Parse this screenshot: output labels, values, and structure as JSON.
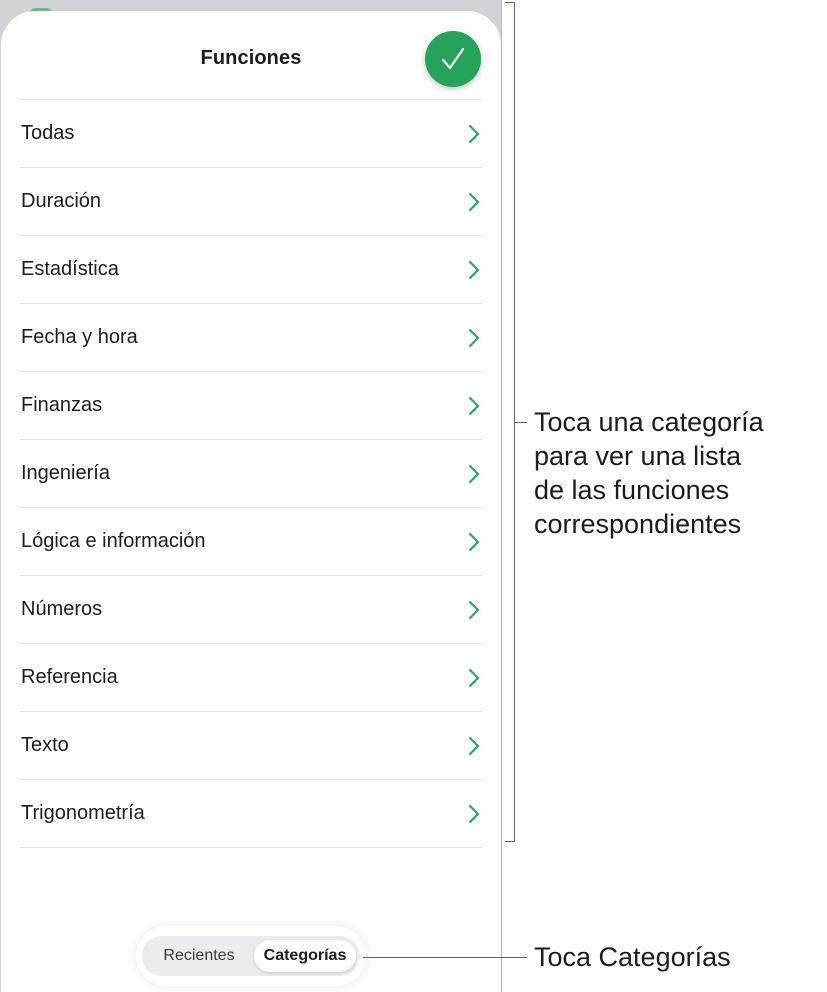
{
  "sheet": {
    "title": "Funciones",
    "done_icon": "checkmark-icon"
  },
  "categories": [
    {
      "label": "Todas"
    },
    {
      "label": "Duración"
    },
    {
      "label": "Estadística"
    },
    {
      "label": "Fecha y hora"
    },
    {
      "label": "Finanzas"
    },
    {
      "label": "Ingeniería"
    },
    {
      "label": "Lógica e información"
    },
    {
      "label": "Números"
    },
    {
      "label": "Referencia"
    },
    {
      "label": "Texto"
    },
    {
      "label": "Trigonometría"
    }
  ],
  "segmented": {
    "recientes": "Recientes",
    "categorias": "Categorías",
    "selected": "Categorías"
  },
  "callouts": {
    "categories_line1": "Toca una categoría",
    "categories_line2": "para ver una lista",
    "categories_line3": "de las funciones",
    "categories_line4": "correspondientes",
    "tab": "Toca Categorías"
  },
  "colors": {
    "accent": "#25a35a",
    "chevron": "#25a35a",
    "text": "#1c1c1e",
    "separator": "#e3e3e6"
  }
}
